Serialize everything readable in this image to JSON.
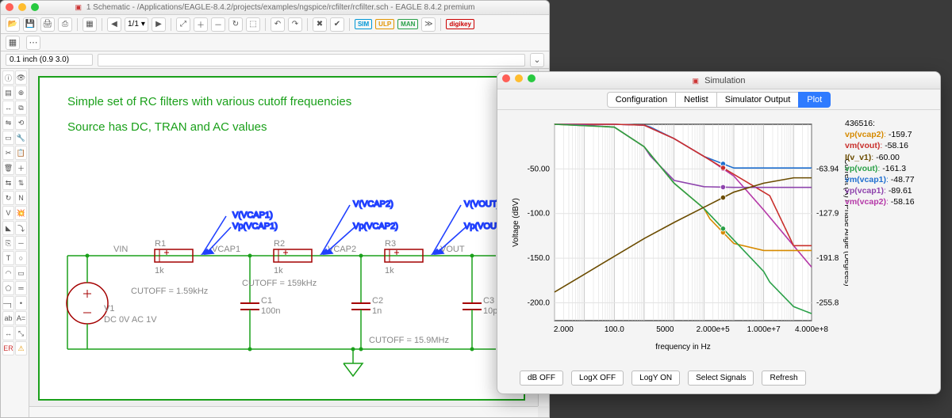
{
  "eagle": {
    "title": "1 Schematic - /Applications/EAGLE-8.4.2/projects/examples/ngspice/rcfilter/rcfilter.sch - EAGLE 8.4.2 premium",
    "toolbar": {
      "sheet": "1/1",
      "badges": {
        "sim": "SIM",
        "ulp": "ULP",
        "man": "MAN",
        "digi": "digikey"
      }
    },
    "coord_bar": {
      "value": "0.1 inch (0.9 3.0)"
    }
  },
  "schematic": {
    "title1": "Simple set of RC filters with various cutoff frequencies",
    "title2": "Source has DC, TRAN and AC values",
    "probes": {
      "v_vcap1": "V(VCAP1)",
      "vp_vcap1": "Vp(VCAP1)",
      "v_vcap2": "V(VCAP2)",
      "vp_vcap2": "Vp(VCAP2)",
      "v_vout": "V(VOUT)",
      "vp_vout": "Vp(VOUT)"
    },
    "nets": {
      "vin": "VIN",
      "vcap1": "VCAP1",
      "vcap2": "VCAP2",
      "vout": "VOUT"
    },
    "parts": {
      "r1": {
        "ref": "R1",
        "val": "1k"
      },
      "r2": {
        "ref": "R2",
        "val": "1k"
      },
      "r3": {
        "ref": "R3",
        "val": "1k"
      },
      "c1": {
        "ref": "C1",
        "val": "100n"
      },
      "c2": {
        "ref": "C2",
        "val": "1n"
      },
      "c3": {
        "ref": "C3",
        "val": "10p"
      },
      "v1": {
        "ref": "V1",
        "desc": "DC 0V AC 1V"
      }
    },
    "cutoffs": {
      "c1": "CUTOFF = 1.59kHz",
      "c2": "CUTOFF = 159kHz",
      "c3": "CUTOFF = 15.9MHz"
    }
  },
  "sim": {
    "title": "Simulation",
    "tabs": [
      "Configuration",
      "Netlist",
      "Simulator Output",
      "Plot"
    ],
    "active_tab": 3,
    "cursor": "436516:",
    "legend": [
      {
        "name": "vp(vcap2)",
        "value": "-159.7",
        "color": "#d68a00"
      },
      {
        "name": "vm(vout)",
        "value": "-58.16",
        "color": "#c9302c"
      },
      {
        "name": "I(v_v1)",
        "value": "-60.00",
        "color": "#6b4c00"
      },
      {
        "name": "vp(vout)",
        "value": "-161.3",
        "color": "#2aa048"
      },
      {
        "name": "vm(vcap1)",
        "value": "-48.77",
        "color": "#1f6fcf"
      },
      {
        "name": "vp(vcap1)",
        "value": "-89.61",
        "color": "#8e44ad"
      },
      {
        "name": "vm(vcap2)",
        "value": "-58.16",
        "color": "#b538a8"
      }
    ],
    "buttons": [
      "dB OFF",
      "LogX OFF",
      "LogY ON",
      "Select Signals",
      "Refresh"
    ],
    "axes": {
      "y_left_label": "Voltage (dBV)",
      "y_right_label": "Current (A) / Phase Angle (Degrees)",
      "x_label": "frequency in Hz",
      "y_left_ticks": [
        "-50.00",
        "-100.0",
        "-150.0",
        "-200.0"
      ],
      "y_right_ticks": [
        "-63.94",
        "-127.9",
        "-191.8",
        "-255.8"
      ],
      "x_ticks": [
        "2.000",
        "100.0",
        "5000",
        "2.000e+5",
        "1.000e+7",
        "4.000e+8"
      ]
    }
  },
  "chart_data": {
    "type": "line",
    "xscale": "log",
    "xlim_hz": [
      1,
      400000000.0
    ],
    "ylim_db": [
      -220,
      0
    ],
    "ylim_phase_deg": [
      -280,
      0
    ],
    "xlabel": "frequency in Hz",
    "ylabel_left": "Voltage (dBV)",
    "ylabel_right": "Current (A) / Phase Angle (Degrees)",
    "cursor_hz": 436516,
    "series": [
      {
        "name": "vm(vcap1)",
        "axis": "dB",
        "color": "#1f6fcf",
        "x": [
          1,
          10,
          100,
          1000,
          1590,
          10000.0,
          100000.0,
          1000000.0,
          10000000.0,
          100000000.0,
          400000000.0
        ],
        "y": [
          0,
          0,
          0,
          -1,
          -3,
          -16,
          -36,
          -49,
          -49,
          -49,
          -49
        ]
      },
      {
        "name": "vm(vcap2)",
        "axis": "dB",
        "color": "#b538a8",
        "x": [
          1,
          100,
          1000,
          10000.0,
          100000.0,
          159000.0,
          1000000.0,
          10000000.0,
          100000000.0,
          400000000.0
        ],
        "y": [
          0,
          0,
          -1,
          -16,
          -36,
          -40,
          -58,
          -96,
          -136,
          -160
        ]
      },
      {
        "name": "vm(vout)",
        "axis": "dB",
        "color": "#c9302c",
        "x": [
          1,
          100,
          1000,
          10000.0,
          100000.0,
          1000000.0,
          10000000.0,
          15900000.0,
          100000000.0,
          400000000.0
        ],
        "y": [
          0,
          0,
          -1,
          -16,
          -36,
          -56,
          -76,
          -80,
          -136,
          -136
        ]
      },
      {
        "name": "vp(vcap1)",
        "axis": "deg",
        "color": "#8e44ad",
        "x": [
          1,
          10,
          100,
          1000,
          1590,
          10000.0,
          100000.0,
          1000000.0,
          400000000.0
        ],
        "y": [
          0,
          -1,
          -4,
          -32,
          -45,
          -80,
          -89,
          -90,
          -90
        ]
      },
      {
        "name": "vp(vcap2)",
        "axis": "deg",
        "color": "#d68a00",
        "x": [
          1,
          100,
          1000,
          10000.0,
          100000.0,
          159000.0,
          1000000.0,
          10000000.0,
          400000000.0
        ],
        "y": [
          0,
          -4,
          -32,
          -84,
          -120,
          -135,
          -170,
          -180,
          -180
        ]
      },
      {
        "name": "vp(vout)",
        "axis": "deg",
        "color": "#2aa048",
        "x": [
          1,
          100,
          1000,
          10000.0,
          100000.0,
          1000000.0,
          10000000.0,
          15900000.0,
          100000000.0,
          400000000.0
        ],
        "y": [
          0,
          -4,
          -32,
          -84,
          -120,
          -165,
          -210,
          -225,
          -260,
          -270
        ]
      },
      {
        "name": "I(v_v1)",
        "axis": "dB",
        "color": "#6b4c00",
        "x": [
          1,
          10,
          100,
          1000,
          10000.0,
          100000.0,
          1000000.0,
          10000000.0,
          100000000.0,
          400000000.0
        ],
        "y": [
          -188,
          -168,
          -148,
          -128,
          -110,
          -93,
          -76,
          -66,
          -60,
          -60
        ]
      }
    ]
  }
}
